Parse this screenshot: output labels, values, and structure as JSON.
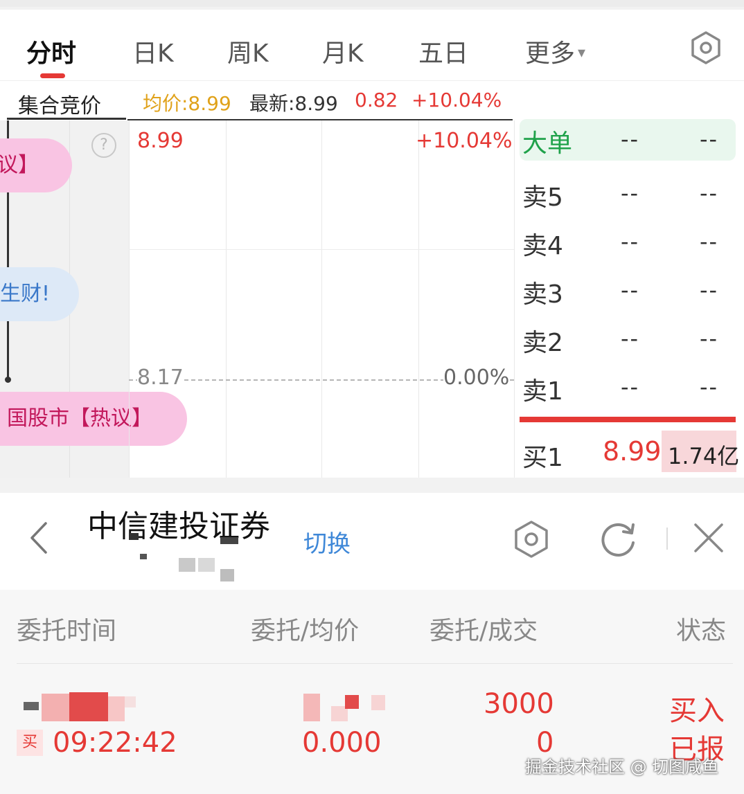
{
  "tabs": [
    {
      "label": "分时",
      "active": true
    },
    {
      "label": "日K",
      "active": false
    },
    {
      "label": "周K",
      "active": false
    },
    {
      "label": "月K",
      "active": false
    },
    {
      "label": "五日",
      "active": false
    },
    {
      "label": "更多",
      "active": false,
      "caret": "▾"
    }
  ],
  "info_bar": {
    "auction_label": "集合竞价",
    "avg_price": "均价:8.99",
    "latest_price": "最新:8.99",
    "change": "0.82",
    "change_pct": "+10.04%"
  },
  "left_strip": {
    "pill_1": "议】",
    "pill_2": "生财!",
    "pill_3": "国股市【热议】",
    "help": "?"
  },
  "chart": {
    "top_price": "8.99",
    "top_pct": "+10.04%",
    "base_price": "8.17",
    "base_pct": "0.00%"
  },
  "order_book": {
    "big_order": {
      "label": "大单",
      "price": "--",
      "volume": "--"
    },
    "asks": [
      {
        "label": "卖5",
        "price": "--",
        "volume": "--"
      },
      {
        "label": "卖4",
        "price": "--",
        "volume": "--"
      },
      {
        "label": "卖3",
        "price": "--",
        "volume": "--"
      },
      {
        "label": "卖2",
        "price": "--",
        "volume": "--"
      },
      {
        "label": "卖1",
        "price": "--",
        "volume": "--"
      }
    ],
    "bid1": {
      "label": "买1",
      "price": "8.99",
      "volume": "1.74亿"
    }
  },
  "broker": {
    "name": "中信建投证券",
    "switch_label": "切换"
  },
  "orders": {
    "headers": [
      "委托时间",
      "委托/均价",
      "委托/成交",
      "状态"
    ],
    "rows": [
      {
        "tag": "买",
        "time": "09:22:42",
        "avg": "0.000",
        "entrust": "3000",
        "filled": "0",
        "side": "买入",
        "status": "已报"
      }
    ]
  },
  "watermark": "掘金技术社区 @ 切图咸鱼",
  "colors": {
    "up": "#e53935",
    "gold": "#e0a21a",
    "green": "#1fa24a",
    "link": "#3f88d8"
  }
}
